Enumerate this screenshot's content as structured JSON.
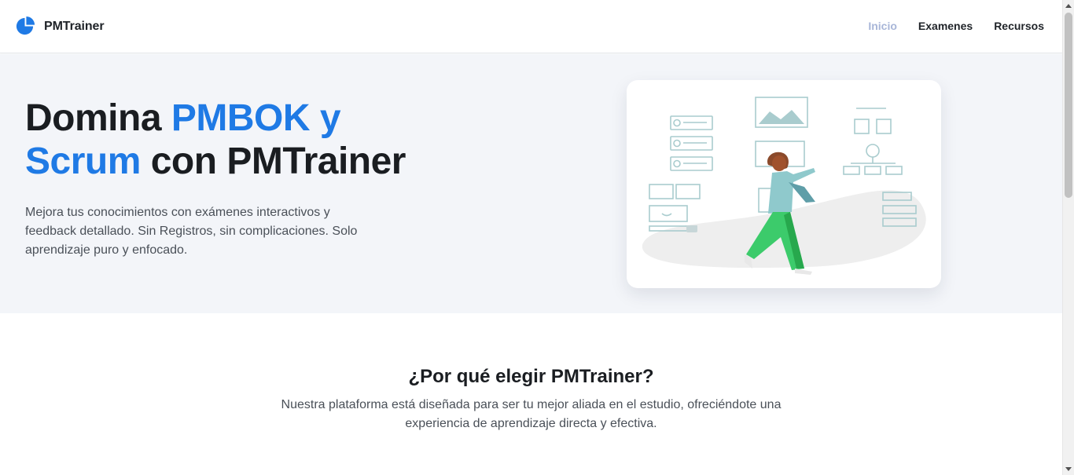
{
  "header": {
    "brand": "PMTrainer",
    "logo_icon": "pie-chart-icon",
    "brand_color": "#1f7ae5",
    "nav": [
      {
        "label": "Inicio",
        "active": true
      },
      {
        "label": "Examenes",
        "active": false
      },
      {
        "label": "Recursos",
        "active": false
      }
    ]
  },
  "hero": {
    "title_part1": "Domina ",
    "title_accent": "PMBOK y Scrum",
    "title_part2": " con PMTrainer",
    "accent_color": "#1f7ae5",
    "description": "Mejora tus conocimientos con exámenes interactivos y feedback detallado. Sin Registros, sin complicaciones. Solo aprendizaje puro y enfocado.",
    "illustration": "person-presenting-dashboard-illustration"
  },
  "features": {
    "title": "¿Por qué elegir PMTrainer?",
    "description": "Nuestra plataforma está diseñada para ser tu mejor aliada en el estudio, ofreciéndote una experiencia de aprendizaje directa y efectiva."
  }
}
